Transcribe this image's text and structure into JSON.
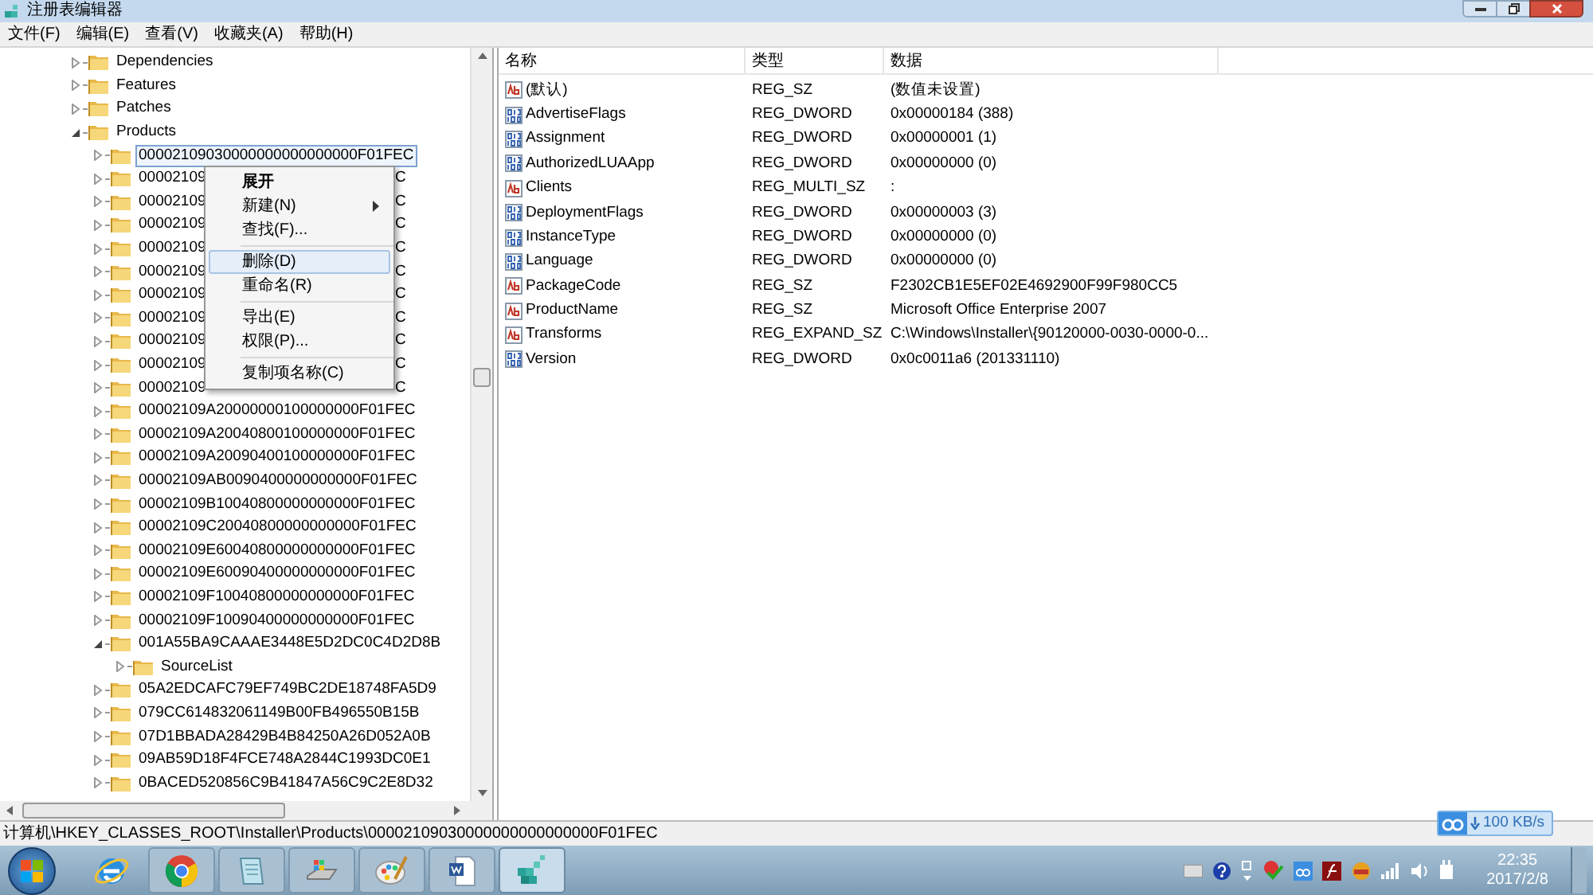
{
  "window": {
    "title": "注册表编辑器"
  },
  "menu": [
    "文件(F)",
    "编辑(E)",
    "查看(V)",
    "收藏夹(A)",
    "帮助(H)"
  ],
  "tree": [
    {
      "label": "Dependencies",
      "expanded": false,
      "selected": false
    },
    {
      "label": "Features",
      "expanded": false,
      "selected": false
    },
    {
      "label": "Patches",
      "expanded": false,
      "selected": false
    },
    {
      "label": "Products",
      "expanded": true,
      "selected": false,
      "children": [
        {
          "label": "00002109030000000000000000F01FEC",
          "expanded": false,
          "selected": true
        },
        {
          "label": "00002109",
          "tail": "C",
          "expanded": false,
          "selected": false
        },
        {
          "label": "00002109",
          "tail": "C",
          "expanded": false,
          "selected": false
        },
        {
          "label": "00002109",
          "tail": "C",
          "expanded": false,
          "selected": false
        },
        {
          "label": "00002109",
          "tail": "C",
          "expanded": false,
          "selected": false
        },
        {
          "label": "00002109",
          "tail": "C",
          "expanded": false,
          "selected": false
        },
        {
          "label": "00002109",
          "tail": "C",
          "expanded": false,
          "selected": false
        },
        {
          "label": "00002109",
          "tail": "C",
          "expanded": false,
          "selected": false
        },
        {
          "label": "00002109",
          "tail": "C",
          "expanded": false,
          "selected": false
        },
        {
          "label": "00002109",
          "tail": "C",
          "expanded": false,
          "selected": false
        },
        {
          "label": "00002109",
          "tail": "C",
          "expanded": false,
          "selected": false
        },
        {
          "label": "00002109A20000000100000000F01FEC",
          "expanded": false,
          "selected": false
        },
        {
          "label": "00002109A20040800100000000F01FEC",
          "expanded": false,
          "selected": false
        },
        {
          "label": "00002109A20090400100000000F01FEC",
          "expanded": false,
          "selected": false
        },
        {
          "label": "00002109AB0090400000000000F01FEC",
          "expanded": false,
          "selected": false
        },
        {
          "label": "00002109B10040800000000000F01FEC",
          "expanded": false,
          "selected": false
        },
        {
          "label": "00002109C20040800000000000F01FEC",
          "expanded": false,
          "selected": false
        },
        {
          "label": "00002109E60040800000000000F01FEC",
          "expanded": false,
          "selected": false
        },
        {
          "label": "00002109E60090400000000000F01FEC",
          "expanded": false,
          "selected": false
        },
        {
          "label": "00002109F10040800000000000F01FEC",
          "expanded": false,
          "selected": false
        },
        {
          "label": "00002109F10090400000000000F01FEC",
          "expanded": false,
          "selected": false
        },
        {
          "label": "001A55BA9CAAAE3448E5D2DC0C4D2D8B",
          "expanded": true,
          "selected": false,
          "children": [
            {
              "label": "SourceList",
              "expanded": false,
              "selected": false
            }
          ]
        },
        {
          "label": "05A2EDCAFC79EF749BC2DE18748FA5D9",
          "expanded": false,
          "selected": false
        },
        {
          "label": "079CC614832061149B00FB496550B15B",
          "expanded": false,
          "selected": false
        },
        {
          "label": "07D1BBADA28429B4B84250A26D052A0B",
          "expanded": false,
          "selected": false
        },
        {
          "label": "09AB59D18F4FCE748A2844C1993DC0E1",
          "expanded": false,
          "selected": false
        },
        {
          "label": "0BACED520856C9B41847A56C9C2E8D32",
          "expanded": false,
          "selected": false
        }
      ]
    }
  ],
  "context_menu": [
    {
      "kind": "item",
      "label": "展开",
      "default": true,
      "submenu": false,
      "selected": false
    },
    {
      "kind": "item",
      "label": "新建(N)",
      "default": false,
      "submenu": true,
      "selected": false
    },
    {
      "kind": "item",
      "label": "查找(F)...",
      "default": false,
      "submenu": false,
      "selected": false
    },
    {
      "kind": "separator"
    },
    {
      "kind": "item",
      "label": "删除(D)",
      "default": false,
      "submenu": false,
      "selected": true
    },
    {
      "kind": "item",
      "label": "重命名(R)",
      "default": false,
      "submenu": false,
      "selected": false
    },
    {
      "kind": "separator"
    },
    {
      "kind": "item",
      "label": "导出(E)",
      "default": false,
      "submenu": false,
      "selected": false
    },
    {
      "kind": "item",
      "label": "权限(P)...",
      "default": false,
      "submenu": false,
      "selected": false
    },
    {
      "kind": "separator"
    },
    {
      "kind": "item",
      "label": "复制项名称(C)",
      "default": false,
      "submenu": false,
      "selected": false
    }
  ],
  "values": {
    "columns": [
      "名称",
      "类型",
      "数据"
    ],
    "rows": [
      {
        "kind": "string",
        "name": "(默认)",
        "type": "REG_SZ",
        "data": "(数值未设置)"
      },
      {
        "kind": "binary",
        "name": "AdvertiseFlags",
        "type": "REG_DWORD",
        "data": "0x00000184 (388)"
      },
      {
        "kind": "binary",
        "name": "Assignment",
        "type": "REG_DWORD",
        "data": "0x00000001 (1)"
      },
      {
        "kind": "binary",
        "name": "AuthorizedLUAApp",
        "type": "REG_DWORD",
        "data": "0x00000000 (0)"
      },
      {
        "kind": "string",
        "name": "Clients",
        "type": "REG_MULTI_SZ",
        "data": ":"
      },
      {
        "kind": "binary",
        "name": "DeploymentFlags",
        "type": "REG_DWORD",
        "data": "0x00000003 (3)"
      },
      {
        "kind": "binary",
        "name": "InstanceType",
        "type": "REG_DWORD",
        "data": "0x00000000 (0)"
      },
      {
        "kind": "binary",
        "name": "Language",
        "type": "REG_DWORD",
        "data": "0x00000000 (0)"
      },
      {
        "kind": "string",
        "name": "PackageCode",
        "type": "REG_SZ",
        "data": "F2302CB1E5EF02E4692900F99F980CC5"
      },
      {
        "kind": "string",
        "name": "ProductName",
        "type": "REG_SZ",
        "data": "Microsoft Office Enterprise 2007"
      },
      {
        "kind": "string",
        "name": "Transforms",
        "type": "REG_EXPAND_SZ",
        "data": "C:\\Windows\\Installer\\{90120000-0030-0000-0..."
      },
      {
        "kind": "binary",
        "name": "Version",
        "type": "REG_DWORD",
        "data": "0x0c0011a6 (201331110)"
      }
    ]
  },
  "status_bar": "计算机\\HKEY_CLASSES_ROOT\\Installer\\Products\\00002109030000000000000000F01FEC",
  "speed_badge": "100 KB/s",
  "taskbar": {
    "apps": [
      {
        "kind": "ie",
        "selected": false
      },
      {
        "kind": "chrome",
        "selected": false
      },
      {
        "kind": "notepad",
        "selected": false
      },
      {
        "kind": "drive",
        "selected": false
      },
      {
        "kind": "paint",
        "selected": false
      },
      {
        "kind": "word",
        "selected": false
      },
      {
        "kind": "regedit",
        "selected": true
      }
    ],
    "time": "22:35",
    "date": "2017/2/8"
  }
}
